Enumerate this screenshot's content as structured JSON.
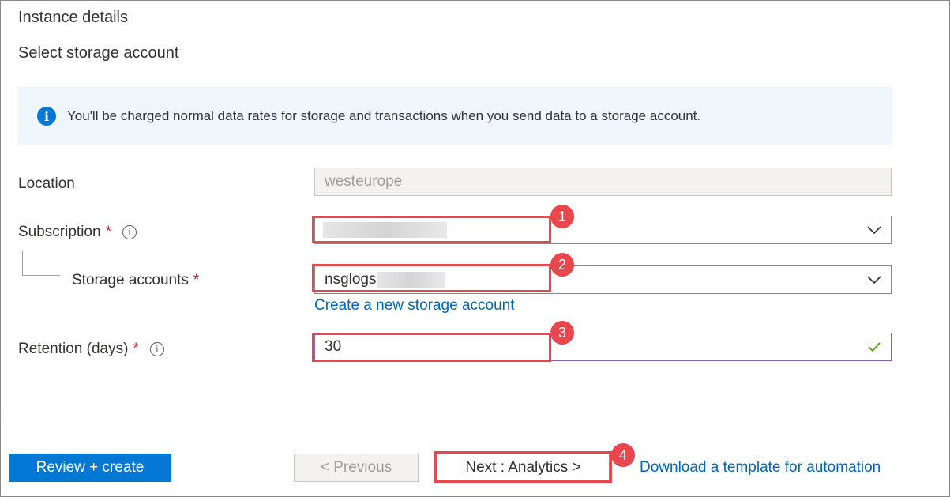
{
  "header": {
    "section_title": "Instance details",
    "sub_title": "Select storage account"
  },
  "info": {
    "icon": "info-icon",
    "text": "You'll be charged normal data rates for storage and transactions when you send data to a storage account."
  },
  "form": {
    "location": {
      "label": "Location",
      "value": "westeurope"
    },
    "subscription": {
      "label": "Subscription",
      "required": "*",
      "value": ""
    },
    "storage_accounts": {
      "label": "Storage accounts",
      "required": "*",
      "value": "nsglogs",
      "create_link": "Create a new storage account"
    },
    "retention": {
      "label": "Retention (days)",
      "required": "*",
      "value": "30"
    }
  },
  "annotations": {
    "badge1": "1",
    "badge2": "2",
    "badge3": "3",
    "badge4": "4",
    "color": "#e8474d"
  },
  "footer": {
    "review_create": "Review + create",
    "previous": "< Previous",
    "next": "Next : Analytics >",
    "download_template": "Download a template for automation"
  },
  "colors": {
    "primary": "#0078d4",
    "link": "#0067b8",
    "required": "#a4262c",
    "info_bg": "#eff6fc",
    "valid_check": "#57a300"
  }
}
